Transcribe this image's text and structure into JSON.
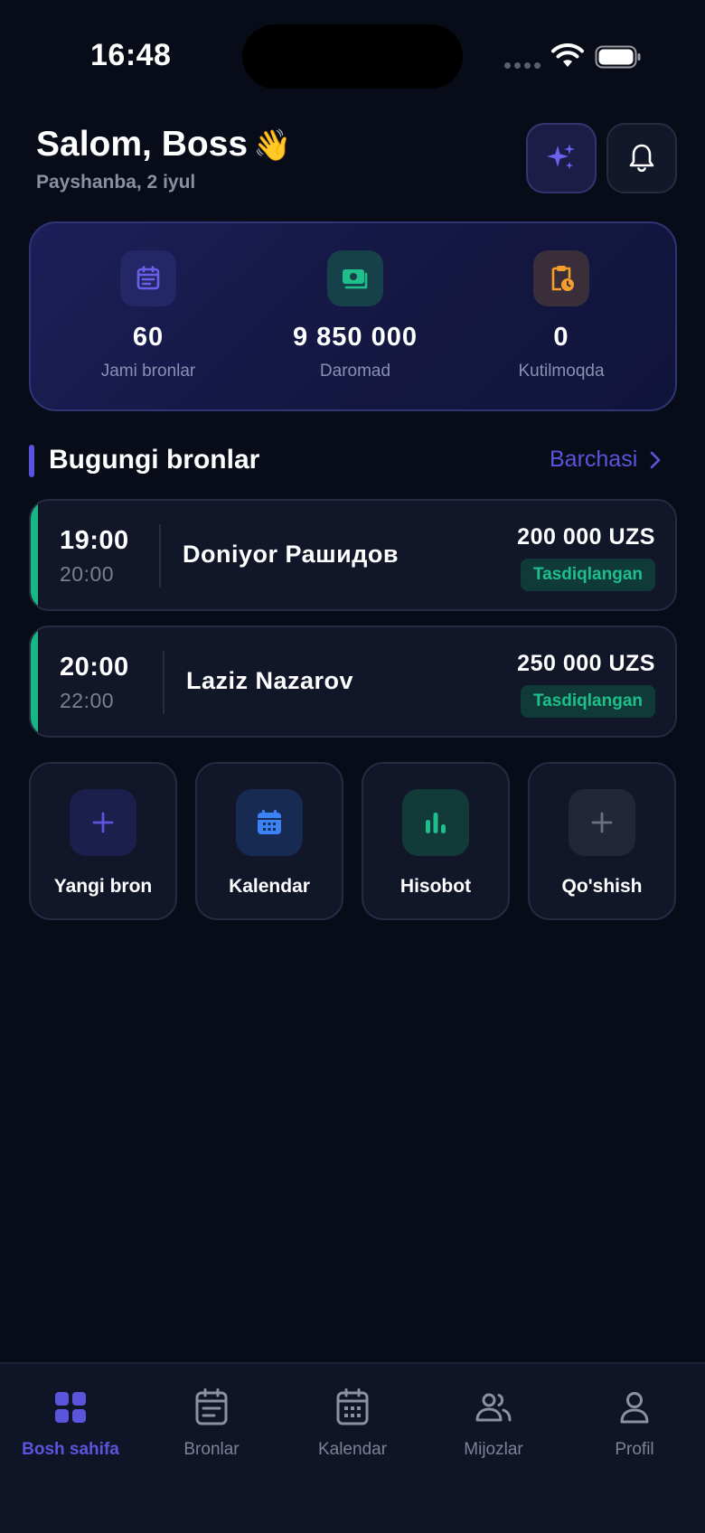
{
  "status_bar": {
    "time": "16:48"
  },
  "header": {
    "greeting": "Salom, Boss",
    "greeting_emoji": "👋",
    "date": "Payshanba, 2 iyul",
    "ai_icon": "sparkles-icon",
    "bell_icon": "bell-icon"
  },
  "stats": [
    {
      "value": "60",
      "label": "Jami bronlar",
      "icon": "calendar-list-icon",
      "color": "#6a5fe8"
    },
    {
      "value": "9 850 000",
      "label": "Daromad",
      "icon": "cash-icon",
      "color": "#1fbf8b"
    },
    {
      "value": "0",
      "label": "Kutilmoqda",
      "icon": "clipboard-clock-icon",
      "color": "#f59e2c"
    }
  ],
  "section": {
    "title": "Bugungi bronlar",
    "see_all": "Barchasi"
  },
  "bookings": [
    {
      "start": "19:00",
      "end": "20:00",
      "name": "Doniyor Рашидов",
      "price": "200 000 UZS",
      "status": "Tasdiqlangan"
    },
    {
      "start": "20:00",
      "end": "22:00",
      "name": "Laziz Nazarov",
      "price": "250 000 UZS",
      "status": "Tasdiqlangan"
    }
  ],
  "quick_actions": [
    {
      "label": "Yangi bron",
      "icon": "plus-icon",
      "color": "#5b55de"
    },
    {
      "label": "Kalendar",
      "icon": "calendar-icon",
      "color": "#3b82f6"
    },
    {
      "label": "Hisobot",
      "icon": "bar-chart-icon",
      "color": "#1fbf8b"
    },
    {
      "label": "Qo'shish",
      "icon": "plus-icon",
      "color": "#6b7085"
    }
  ],
  "tabs": [
    {
      "label": "Bosh sahifa",
      "icon": "grid-icon",
      "active": true
    },
    {
      "label": "Bronlar",
      "icon": "document-icon",
      "active": false
    },
    {
      "label": "Kalendar",
      "icon": "calendar-icon",
      "active": false
    },
    {
      "label": "Mijozlar",
      "icon": "users-icon",
      "active": false
    },
    {
      "label": "Profil",
      "icon": "user-icon",
      "active": false
    }
  ],
  "colors": {
    "accent": "#5b55de",
    "success": "#1fbf8b",
    "background": "#080c18"
  }
}
